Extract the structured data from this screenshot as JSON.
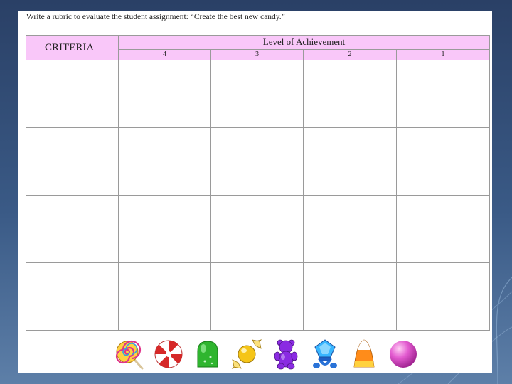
{
  "instruction": "Write a rubric to evaluate the student assignment: “Create the best new candy.”",
  "table": {
    "criteria_header": "CRITERIA",
    "level_header": "Level of Achievement",
    "levels": [
      "4",
      "3",
      "2",
      "1"
    ],
    "rows": [
      [
        "",
        "",
        "",
        "",
        ""
      ],
      [
        "",
        "",
        "",
        "",
        ""
      ],
      [
        "",
        "",
        "",
        "",
        ""
      ],
      [
        "",
        "",
        "",
        "",
        ""
      ]
    ]
  },
  "candies": [
    "lollipop-icon",
    "peppermint-icon",
    "gumdrop-icon",
    "wrapped-candy-icon",
    "gummy-bear-icon",
    "ring-pop-icon",
    "candy-corn-icon",
    "gumball-icon"
  ],
  "colors": {
    "header_bg": "#f9c7f9",
    "background": "#2a4066"
  }
}
